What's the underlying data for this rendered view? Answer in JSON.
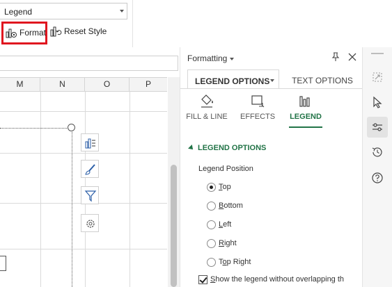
{
  "toolbar": {
    "element_select_value": "Legend",
    "format_label": "Format",
    "reset_label": "Reset Style"
  },
  "sheet": {
    "columns": [
      "M",
      "N",
      "O",
      "P"
    ]
  },
  "pane": {
    "title": "Formatting",
    "tabs": {
      "legend_options": "LEGEND OPTIONS",
      "text_options": "TEXT OPTIONS"
    },
    "categories": [
      {
        "label": "FILL & LINE",
        "icon": "fill-bucket-icon"
      },
      {
        "label": "EFFECTS",
        "icon": "effects-icon"
      },
      {
        "label": "LEGEND",
        "icon": "legend-bars-icon"
      }
    ],
    "section_title": "LEGEND OPTIONS",
    "position_label": "Legend Position",
    "positions": [
      {
        "label": "Top",
        "checked": true
      },
      {
        "label": "Bottom",
        "checked": false
      },
      {
        "label": "Left",
        "checked": false
      },
      {
        "label": "Right",
        "checked": false
      },
      {
        "label": "Top Right",
        "checked": false
      }
    ],
    "overlap_label": "Show the legend without overlapping th",
    "overlap_checked": true
  },
  "colors": {
    "accent_green": "#217346",
    "highlight_red": "#e0151f"
  }
}
